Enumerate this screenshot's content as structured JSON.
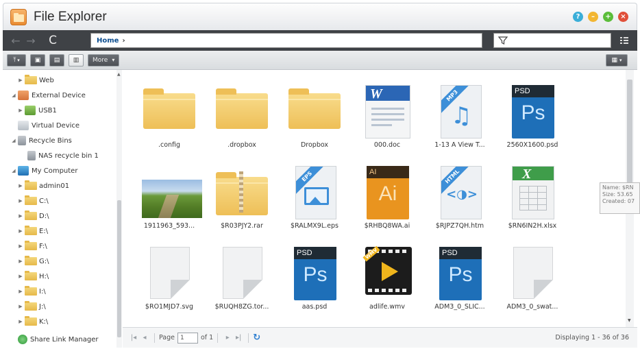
{
  "window": {
    "title": "File Explorer",
    "buttons": [
      {
        "name": "help",
        "glyph": "?",
        "color": "#3aaed8"
      },
      {
        "name": "minimize",
        "glyph": "–",
        "color": "#f2b632"
      },
      {
        "name": "maximize",
        "glyph": "+",
        "color": "#5bbd3a"
      },
      {
        "name": "close",
        "glyph": "×",
        "color": "#e0503a"
      }
    ]
  },
  "nav": {
    "back_icon": "back-arrow-icon",
    "forward_icon": "forward-arrow-icon",
    "refresh_glyph": "C",
    "path_label": "Home",
    "path_separator": "›",
    "filter_value": ""
  },
  "toolbar": {
    "more_label": "More",
    "more_arrow": "▾"
  },
  "sidebar": {
    "items": [
      {
        "label": "Web",
        "icon": "folder-web-icon"
      },
      {
        "label": "External Device",
        "icon": "external-device-icon"
      },
      {
        "label": "USB1",
        "icon": "usb-icon"
      },
      {
        "label": "Virtual Device",
        "icon": "virtual-device-icon"
      },
      {
        "label": "Recycle Bins",
        "icon": "recycle-bin-icon"
      },
      {
        "label": "NAS recycle bin 1",
        "icon": "recycle-bin-icon"
      },
      {
        "label": "My Computer",
        "icon": "computer-icon"
      },
      {
        "label": "admin01",
        "icon": "folder-icon"
      },
      {
        "label": "C:\\",
        "icon": "folder-icon"
      },
      {
        "label": "D:\\",
        "icon": "folder-icon"
      },
      {
        "label": "E:\\",
        "icon": "folder-icon"
      },
      {
        "label": "F:\\",
        "icon": "folder-icon"
      },
      {
        "label": "G:\\",
        "icon": "folder-icon"
      },
      {
        "label": "H:\\",
        "icon": "folder-icon"
      },
      {
        "label": "I:\\",
        "icon": "folder-icon"
      },
      {
        "label": "J:\\",
        "icon": "folder-icon"
      },
      {
        "label": "K:\\",
        "icon": "folder-icon"
      },
      {
        "label": "Share Link Manager",
        "icon": "share-link-icon"
      }
    ]
  },
  "files": [
    {
      "name": ".config",
      "type": "folder"
    },
    {
      "name": ".dropbox",
      "type": "folder"
    },
    {
      "name": "Dropbox",
      "type": "folder"
    },
    {
      "name": "000.doc",
      "type": "word",
      "badge": "W"
    },
    {
      "name": "1-13 A View T...",
      "type": "mp3",
      "badge": "MP3",
      "glyph": "♫"
    },
    {
      "name": "2560X1600.psd",
      "type": "psd",
      "badge": "PSD",
      "glyph": "Ps"
    },
    {
      "name": "1911963_593...",
      "type": "photo"
    },
    {
      "name": "$R03PJY2.rar",
      "type": "rar"
    },
    {
      "name": "$RALMX9L.eps",
      "type": "eps",
      "badge": "EPS"
    },
    {
      "name": "$RHBQ8WA.ai",
      "type": "ai",
      "badge": "AI",
      "glyph": "Ai"
    },
    {
      "name": "$RJPZ7QH.htm",
      "type": "html",
      "badge": "HTML",
      "glyph": "<◑>"
    },
    {
      "name": "$RN6IN2H.xlsx",
      "type": "xlsx",
      "badge": "X"
    },
    {
      "name": "$RO1MJD7.svg",
      "type": "blank"
    },
    {
      "name": "$RUQH8ZG.tor...",
      "type": "blank"
    },
    {
      "name": "aas.psd",
      "type": "psd",
      "badge": "PSD",
      "glyph": "Ps"
    },
    {
      "name": "adlife.wmv",
      "type": "video",
      "badge": "WMV"
    },
    {
      "name": "ADM3_0_SLIC...",
      "type": "psd",
      "badge": "PSD",
      "glyph": "Ps"
    },
    {
      "name": "ADM3_0_swat...",
      "type": "blank"
    }
  ],
  "tooltip": {
    "line1": "Name: $RN",
    "line2": "Size: 53.65",
    "line3": "Created: 07"
  },
  "pager": {
    "page_label": "Page",
    "page_value": "1",
    "of_label": "of 1",
    "displaying": "Displaying 1 - 36 of 36"
  }
}
